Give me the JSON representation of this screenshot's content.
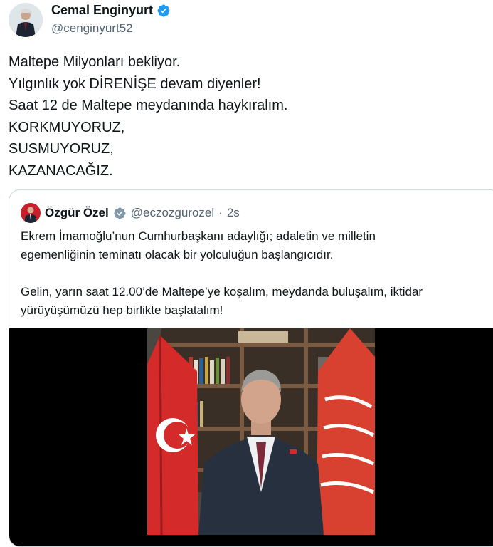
{
  "author": {
    "name": "Cemal Enginyurt",
    "handle": "@cenginyurt52",
    "verified_icon": "verified-badge-icon",
    "verified_color": "#1d9bf0"
  },
  "tweet": {
    "lines": [
      "Maltepe Milyonları bekliyor.",
      "Yılgınlık yok DİRENİŞE devam diyenler!",
      "Saat 12 de Maltepe meydanında haykıralım.",
      "KORKMUYORUZ,",
      "SUSMUYORUZ,",
      "KAZANACAĞIZ."
    ]
  },
  "quoted_tweet": {
    "name": "Özgür Özel",
    "verified_icon": "verified-badge-icon",
    "handle": "@eczozgurozel",
    "separator": "·",
    "time": "2s",
    "paragraph1": [
      "Ekrem İmamoğlu’nun Cumhurbaşkanı adaylığı; adaletin ve milletin",
      "egemenliğinin teminatı olacak bir yolculuğun başlangıcıdır."
    ],
    "paragraph2": [
      "Gelin, yarın saat 12.00’de Maltepe’ye koşalım, meydanda buluşalım, iktidar",
      "yürüyüşümüzü hep birlikte başlatalım!"
    ],
    "media_type": "video"
  },
  "colors": {
    "text": "#0f1419",
    "secondary": "#536471",
    "border": "#cfd9de",
    "flag_red": "#e30a17"
  }
}
